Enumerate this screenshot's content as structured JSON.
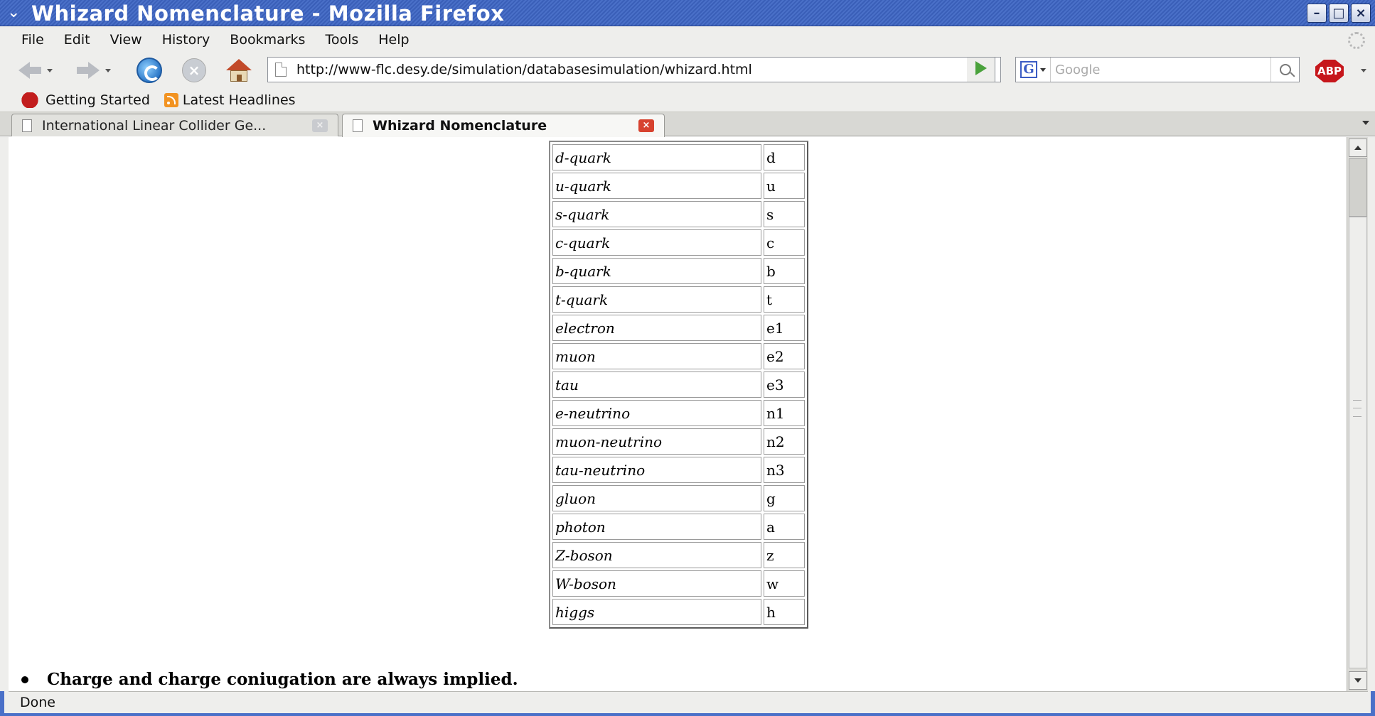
{
  "window": {
    "title": "Whizard Nomenclature - Mozilla Firefox",
    "minimize": "–",
    "maximize": "□",
    "close": "×"
  },
  "menubar": {
    "items": [
      "File",
      "Edit",
      "View",
      "History",
      "Bookmarks",
      "Tools",
      "Help"
    ]
  },
  "navbar": {
    "url": "http://www-flc.desy.de/simulation/databasesimulation/whizard.html",
    "search_placeholder": "Google",
    "search_engine_letter": "G",
    "adblock_label": "ABP"
  },
  "bookmarks": {
    "items": [
      "Getting Started",
      "Latest Headlines"
    ]
  },
  "tabs": [
    {
      "label": "International Linear Collider Ge...",
      "active": false
    },
    {
      "label": "Whizard Nomenclature",
      "active": true
    }
  ],
  "particles": [
    {
      "name": "d-quark",
      "code": "d"
    },
    {
      "name": "u-quark",
      "code": "u"
    },
    {
      "name": "s-quark",
      "code": "s"
    },
    {
      "name": "c-quark",
      "code": "c"
    },
    {
      "name": "b-quark",
      "code": "b"
    },
    {
      "name": "t-quark",
      "code": "t"
    },
    {
      "name": "electron",
      "code": "e1"
    },
    {
      "name": "muon",
      "code": "e2"
    },
    {
      "name": "tau",
      "code": "e3"
    },
    {
      "name": "e-neutrino",
      "code": "n1"
    },
    {
      "name": "muon-neutrino",
      "code": "n2"
    },
    {
      "name": "tau-neutrino",
      "code": "n3"
    },
    {
      "name": "gluon",
      "code": "g"
    },
    {
      "name": "photon",
      "code": "a"
    },
    {
      "name": "Z-boson",
      "code": "z"
    },
    {
      "name": "W-boson",
      "code": "w"
    },
    {
      "name": "higgs",
      "code": "h"
    }
  ],
  "note": "Charge and charge coniugation are always implied.",
  "status": "Done",
  "colors": {
    "titlebar": "#3a5fb8",
    "chrome": "#eeeeec",
    "tab_close_active": "#d7422f",
    "adblock": "#c6161b"
  }
}
